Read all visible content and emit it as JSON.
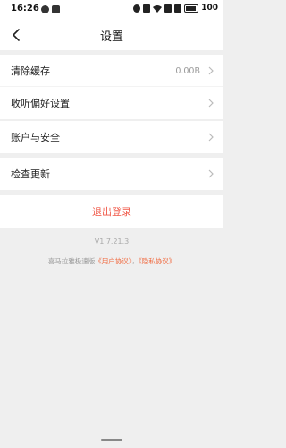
{
  "status_bar": {
    "time": "16:26",
    "battery": "100"
  },
  "header": {
    "title": "设置"
  },
  "settings": {
    "items": [
      {
        "label": "清除缓存",
        "value": "0.00B"
      },
      {
        "label": "收听偏好设置"
      },
      {
        "label": "账户与安全"
      },
      {
        "label": "检查更新"
      }
    ]
  },
  "logout": {
    "label": "退出登录"
  },
  "footer": {
    "version": "V1.7.21.3",
    "app_name": "喜马拉雅极速版",
    "user_agreement": "《用户协议》",
    "separator": "，",
    "privacy_policy": "《隐私协议》"
  },
  "colors": {
    "accent": "#f05a4a",
    "link": "#f0673c",
    "background": "#efefef"
  },
  "icons": {
    "back": "chevron-left-icon",
    "row_arrow": "chevron-right-icon"
  }
}
